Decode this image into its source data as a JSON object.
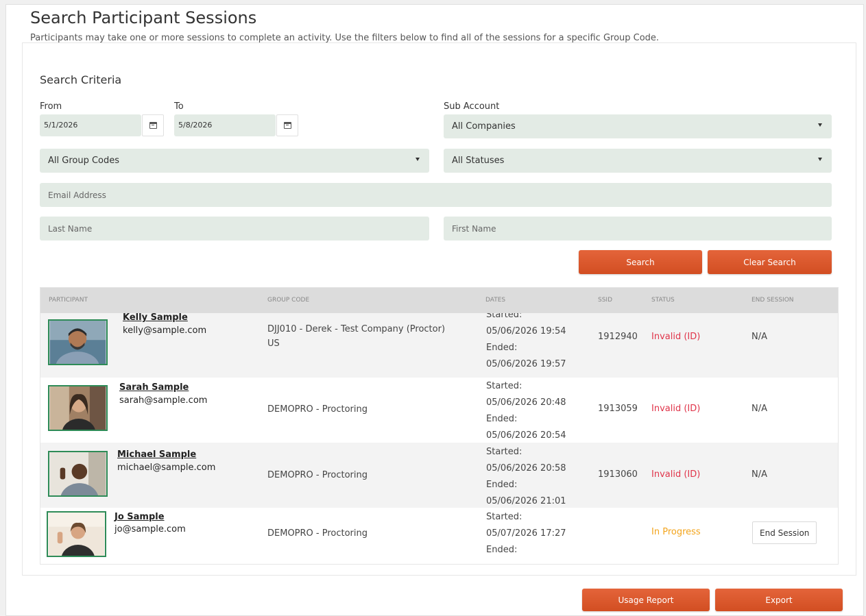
{
  "page": {
    "title": "Search Participant Sessions",
    "description": "Participants may take one or more sessions to complete an activity. Use the filters below to find all of the sessions for a specific Group Code."
  },
  "search": {
    "heading": "Search Criteria",
    "from_label": "From",
    "from_value": "5/1/2026",
    "to_label": "To",
    "to_value": "5/8/2026",
    "sub_account_label": "Sub Account",
    "sub_account_value": "All Companies",
    "group_codes_value": "All Group Codes",
    "statuses_value": "All Statuses",
    "email_placeholder": "Email Address",
    "last_name_placeholder": "Last Name",
    "first_name_placeholder": "First Name",
    "search_button": "Search",
    "clear_button": "Clear Search"
  },
  "table": {
    "headers": [
      "Participant",
      "Group Code",
      "Dates",
      "SSID",
      "Status",
      "End Session"
    ],
    "rows": [
      {
        "name": "Kelly Sample",
        "email": "kelly@sample.com",
        "group_line1": "DJJ010 - Derek - Test Company (Proctor)",
        "group_line2": "US",
        "started_label": "Started:",
        "started": "05/06/2026 19:54",
        "ended_label": "Ended:",
        "ended": "05/06/2026 19:57",
        "ssid": "1912940",
        "status": "Invalid (ID)",
        "end_session": "N/A"
      },
      {
        "name": "Sarah Sample",
        "email": "sarah@sample.com",
        "group_line1": "DEMOPRO - Proctoring",
        "started_label": "Started:",
        "started": "05/06/2026 20:48",
        "ended_label": "Ended:",
        "ended": "05/06/2026 20:54",
        "ssid": "1913059",
        "status": "Invalid (ID)",
        "end_session": "N/A"
      },
      {
        "name": "Michael Sample",
        "email": "michael@sample.com",
        "group_line1": "DEMOPRO - Proctoring",
        "started_label": "Started:",
        "started": "05/06/2026 20:58",
        "ended_label": "Ended:",
        "ended": "05/06/2026 21:01",
        "ssid": "1913060",
        "status": "Invalid (ID)",
        "end_session": "N/A"
      },
      {
        "name": "Jo Sample",
        "email": "jo@sample.com",
        "group_line1": "DEMOPRO - Proctoring",
        "started_label": "Started:",
        "started": "05/07/2026 17:27",
        "ended_label": "Ended:",
        "ssid": "",
        "status": "In Progress",
        "end_session_button": "End Session"
      }
    ]
  },
  "footer": {
    "usage_report_button": "Usage Report",
    "export_button": "Export"
  },
  "colors": {
    "accent": "#d9552a",
    "input_bg": "#e3ebe5",
    "status_invalid": "#e0344a",
    "status_in_progress": "#f3a41b",
    "avatar_border": "#2e8b57"
  }
}
